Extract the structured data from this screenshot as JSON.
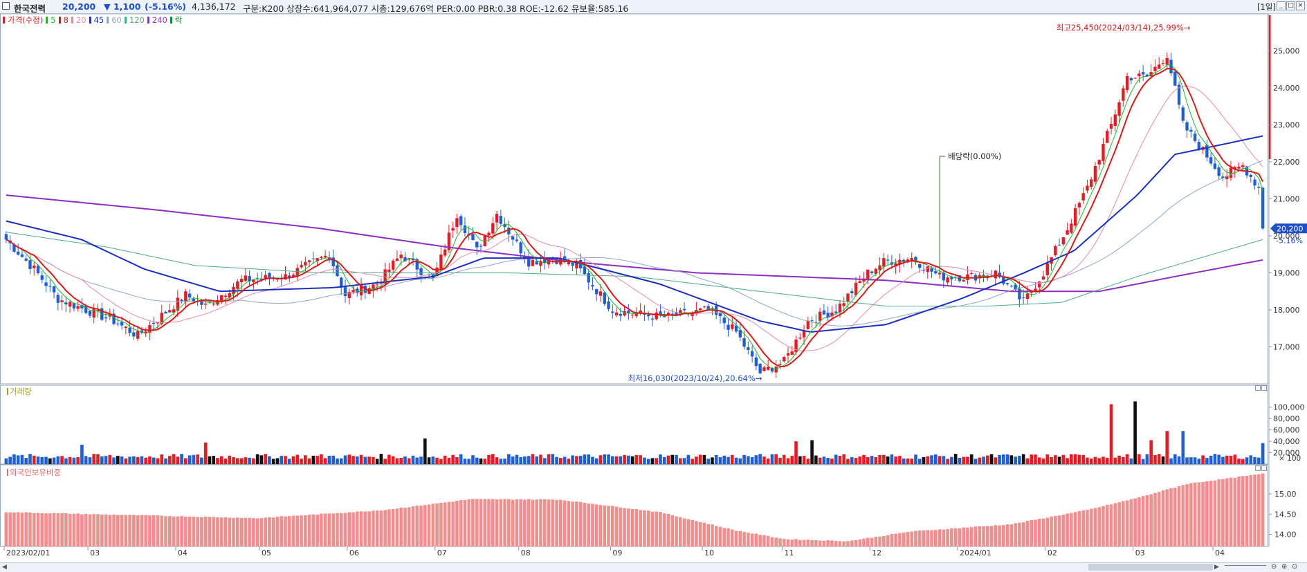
{
  "header": {
    "stock_name": "한국전력",
    "price": "20,200",
    "change": "▼ 1,100",
    "change_pct": "(-5.16%)",
    "volume": "4,136,172",
    "stats": "구분:K200 상장수:641,964,077 시총:129,676억 PER:0.00 PBR:0.38 ROE:-12.62 유보율:585.16",
    "period": "[1일]"
  },
  "colors": {
    "up": "#e51c23",
    "down": "#1f5fd1",
    "ma5": "#21b32b",
    "ma8": "#d81a1a",
    "ma20": "#e08ab0",
    "ma45": "#1b2fbd",
    "ma60": "#8fa5c8",
    "ma120": "#4bab7e",
    "ma240": "#8b2fc1",
    "foreign": "#f18e8e"
  },
  "legend": [
    {
      "label": "가격(수정)",
      "color": "#d71d1d"
    },
    {
      "label": "5",
      "color": "#21b32b"
    },
    {
      "label": "8",
      "color": "#d81a1a"
    },
    {
      "label": "20",
      "color": "#e08ab0"
    },
    {
      "label": "45",
      "color": "#1b2fbd"
    },
    {
      "label": "60",
      "color": "#8fa5c8"
    },
    {
      "label": "120",
      "color": "#4bab7e"
    },
    {
      "label": "240",
      "color": "#8b2fc1"
    },
    {
      "label": "락",
      "color": "#0b8a2f"
    }
  ],
  "volume_panel": {
    "title": "거래량",
    "unit": "× 100"
  },
  "foreign_panel": {
    "title": "외국인보유비중"
  },
  "annotations": {
    "high": "최고25,450(2024/03/14),25.99%→",
    "low": "최저16,030(2023/10/24),20.64%→",
    "dividend": "배당락(0.00%)",
    "last_price": "20,200",
    "last_pct": "-5.16%"
  },
  "chart_data": {
    "type": "candlestick",
    "x_labels": [
      "2023/02/01",
      "03",
      "04",
      "05",
      "06",
      "07",
      "08",
      "09",
      "10",
      "11",
      "12",
      "2024/01",
      "02",
      "03",
      "04"
    ],
    "price_axis": {
      "ticks": [
        17000,
        18000,
        19000,
        20000,
        21000,
        22000,
        23000,
        24000,
        25000
      ],
      "ylim": [
        16000,
        26000
      ]
    },
    "volume_axis": {
      "ticks": [
        20000,
        40000,
        60000,
        80000,
        100000
      ],
      "ylim": [
        0,
        125000
      ]
    },
    "foreign_axis": {
      "ticks": [
        14.0,
        14.5,
        15.0
      ],
      "ylim": [
        13.7,
        15.55
      ]
    },
    "close_anchors": [
      {
        "date": "2023-02-01",
        "close": 19900
      },
      {
        "date": "2023-02-10",
        "close": 19100
      },
      {
        "date": "2023-02-20",
        "close": 18300
      },
      {
        "date": "2023-03-10",
        "close": 17700
      },
      {
        "date": "2023-03-20",
        "close": 17300
      },
      {
        "date": "2023-04-05",
        "close": 18400
      },
      {
        "date": "2023-04-12",
        "close": 18100
      },
      {
        "date": "2023-04-25",
        "close": 18800
      },
      {
        "date": "2023-05-10",
        "close": 18900
      },
      {
        "date": "2023-05-25",
        "close": 19500
      },
      {
        "date": "2023-05-31",
        "close": 18400
      },
      {
        "date": "2023-06-12",
        "close": 18700
      },
      {
        "date": "2023-06-20",
        "close": 19500
      },
      {
        "date": "2023-06-30",
        "close": 18800
      },
      {
        "date": "2023-07-05",
        "close": 19700
      },
      {
        "date": "2023-07-10",
        "close": 20600
      },
      {
        "date": "2023-07-17",
        "close": 19600
      },
      {
        "date": "2023-07-24",
        "close": 20600
      },
      {
        "date": "2023-08-03",
        "close": 19300
      },
      {
        "date": "2023-08-11",
        "close": 19400
      },
      {
        "date": "2023-08-21",
        "close": 19200
      },
      {
        "date": "2023-09-01",
        "close": 18000
      },
      {
        "date": "2023-09-08",
        "close": 17900
      },
      {
        "date": "2023-09-20",
        "close": 17800
      },
      {
        "date": "2023-10-05",
        "close": 18000
      },
      {
        "date": "2023-10-16",
        "close": 17400
      },
      {
        "date": "2023-10-24",
        "close": 16300
      },
      {
        "date": "2023-11-01",
        "close": 16600
      },
      {
        "date": "2023-11-09",
        "close": 17700
      },
      {
        "date": "2023-11-20",
        "close": 18000
      },
      {
        "date": "2023-11-30",
        "close": 19000
      },
      {
        "date": "2023-12-06",
        "close": 19300
      },
      {
        "date": "2023-12-15",
        "close": 19400
      },
      {
        "date": "2023-12-26",
        "close": 18900
      },
      {
        "date": "2024-01-05",
        "close": 18900
      },
      {
        "date": "2024-01-15",
        "close": 19000
      },
      {
        "date": "2024-01-24",
        "close": 18200
      },
      {
        "date": "2024-01-31",
        "close": 19000
      },
      {
        "date": "2024-02-08",
        "close": 20200
      },
      {
        "date": "2024-02-15",
        "close": 21300
      },
      {
        "date": "2024-02-23",
        "close": 23000
      },
      {
        "date": "2024-02-29",
        "close": 24300
      },
      {
        "date": "2024-03-07",
        "close": 24300
      },
      {
        "date": "2024-03-14",
        "close": 24900
      },
      {
        "date": "2024-03-20",
        "close": 23000
      },
      {
        "date": "2024-03-27",
        "close": 22300
      },
      {
        "date": "2024-04-03",
        "close": 21600
      },
      {
        "date": "2024-04-10",
        "close": 21900
      },
      {
        "date": "2024-04-16",
        "close": 21300
      },
      {
        "date": "2024-04-17",
        "close": 20200
      }
    ],
    "ma_levels": {
      "ma45": [
        [
          0,
          20400
        ],
        [
          0.06,
          19900
        ],
        [
          0.11,
          19100
        ],
        [
          0.17,
          18500
        ],
        [
          0.26,
          18600
        ],
        [
          0.34,
          18900
        ],
        [
          0.38,
          19400
        ],
        [
          0.44,
          19400
        ],
        [
          0.52,
          18700
        ],
        [
          0.6,
          17700
        ],
        [
          0.64,
          17400
        ],
        [
          0.7,
          17600
        ],
        [
          0.76,
          18300
        ],
        [
          0.81,
          19000
        ],
        [
          0.85,
          19600
        ],
        [
          0.9,
          21100
        ],
        [
          0.93,
          22200
        ],
        [
          1,
          22700
        ]
      ],
      "ma120": [
        [
          0,
          20100
        ],
        [
          0.08,
          19700
        ],
        [
          0.15,
          19200
        ],
        [
          0.25,
          19000
        ],
        [
          0.4,
          19000
        ],
        [
          0.5,
          18900
        ],
        [
          0.6,
          18500
        ],
        [
          0.7,
          18100
        ],
        [
          0.78,
          18100
        ],
        [
          0.84,
          18200
        ],
        [
          0.9,
          18900
        ],
        [
          1,
          19900
        ]
      ],
      "ma240": [
        [
          0,
          21100
        ],
        [
          0.12,
          20700
        ],
        [
          0.25,
          20200
        ],
        [
          0.35,
          19700
        ],
        [
          0.45,
          19300
        ],
        [
          0.55,
          19000
        ],
        [
          0.7,
          18800
        ],
        [
          0.8,
          18500
        ],
        [
          0.87,
          18500
        ],
        [
          0.93,
          18900
        ],
        [
          1,
          19350
        ]
      ]
    },
    "volume_spikes": [
      {
        "date": "2023-02-28",
        "value": 34000
      },
      {
        "date": "2023-04-12",
        "value": 38000
      },
      {
        "date": "2023-06-28",
        "value": 45000
      },
      {
        "date": "2023-11-06",
        "value": 40000
      },
      {
        "date": "2023-11-10",
        "value": 42000
      },
      {
        "date": "2024-02-23",
        "value": 105000
      },
      {
        "date": "2024-03-04",
        "value": 110000
      },
      {
        "date": "2024-03-08",
        "value": 42000
      },
      {
        "date": "2024-03-14",
        "value": 58000
      },
      {
        "date": "2024-03-20",
        "value": 58000
      },
      {
        "date": "2024-04-17",
        "value": 37000
      }
    ],
    "foreign_anchors": [
      [
        0,
        14.55
      ],
      [
        0.2,
        14.4
      ],
      [
        0.3,
        14.6
      ],
      [
        0.37,
        14.87
      ],
      [
        0.44,
        14.86
      ],
      [
        0.52,
        14.55
      ],
      [
        0.58,
        14.1
      ],
      [
        0.62,
        13.88
      ],
      [
        0.67,
        13.83
      ],
      [
        0.72,
        14.07
      ],
      [
        0.8,
        14.25
      ],
      [
        0.86,
        14.6
      ],
      [
        0.9,
        14.9
      ],
      [
        0.94,
        15.25
      ],
      [
        1,
        15.5
      ]
    ]
  }
}
